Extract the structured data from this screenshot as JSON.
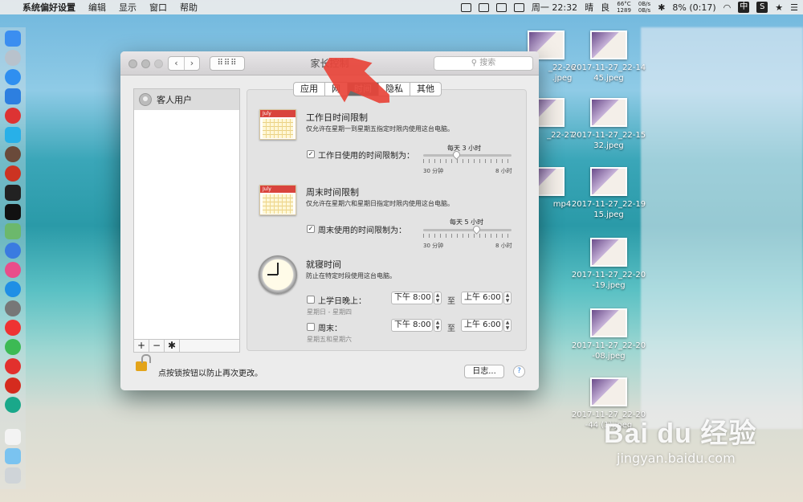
{
  "menubar": {
    "app_name": "系统偏好设置",
    "menus": [
      "编辑",
      "显示",
      "窗口",
      "帮助"
    ],
    "clock": "周一 22:32",
    "weather": "晴",
    "air": "良",
    "cpu_temp": "66°C",
    "cpu_value": "1289",
    "net_up": "0B/s",
    "net_down": "0B/s",
    "battery": "8% (0:17)",
    "input_method": "中",
    "s_badge": "S"
  },
  "window": {
    "title": "家长控制",
    "search_placeholder": "搜索",
    "grid_button": "⠿⠿⠿",
    "users": [
      {
        "name": "客人用户"
      }
    ],
    "list_controls": {
      "add": "+",
      "remove": "−",
      "action": "✱"
    },
    "tabs": [
      {
        "label": "应用",
        "active": false
      },
      {
        "label": "网",
        "active": false
      },
      {
        "label": "时间",
        "active": true
      },
      {
        "label": "隐私",
        "active": false
      },
      {
        "label": "其他",
        "active": false
      }
    ],
    "weekday": {
      "title": "工作日时间限制",
      "desc": "仅允许在星期一到星期五指定时限内使用这台电脑。",
      "checkbox_label": "工作日使用的时间限制为：",
      "checked": true,
      "slider_value": "每天 3 小时",
      "slider_fraction": 0.37,
      "min_label": "30 分钟",
      "max_label": "8 小时"
    },
    "weekend": {
      "title": "周末时间限制",
      "desc": "仅允许在星期六和星期日指定时限内使用这台电脑。",
      "checkbox_label": "周末使用的时间限制为：",
      "checked": true,
      "slider_value": "每天 5 小时",
      "slider_fraction": 0.6,
      "min_label": "30 分钟",
      "max_label": "8 小时"
    },
    "bedtime": {
      "title": "就寝时间",
      "desc": "防止在特定时段使用这台电脑。",
      "school_nights": {
        "label": "上学日晚上：",
        "checked": false,
        "from": "下午 8:00",
        "to": "上午 6:00",
        "days": "星期日 - 星期四"
      },
      "weekend": {
        "label": "周末：",
        "checked": false,
        "from": "下午 8:00",
        "to": "上午 6:00",
        "days": "星期五和星期六"
      },
      "to_word": "至"
    },
    "footer": {
      "lock_text": "点按锁按钮以防止再次更改。",
      "log_button": "日志...",
      "help_button": "?"
    }
  },
  "calendar_month": "July",
  "desktop_files": [
    {
      "label": "_22-26\n.jpeg"
    },
    {
      "label": "2017-11-27_22-14\n45.jpeg"
    },
    {
      "label": "_22-27-"
    },
    {
      "label": "2017-11-27_22-15\n32.jpeg"
    },
    {
      "label": "mp4"
    },
    {
      "label": "2017-11-27_22-19\n15.jpeg"
    },
    {
      "label": "2017-11-27_22-20\n-19.jpeg"
    },
    {
      "label": "2017-11-27_22-20\n-08.jpeg"
    },
    {
      "label": "2017-11-27_22-20\n-44 (1).jpeg"
    }
  ],
  "watermark": {
    "main": "Bai du 经验",
    "sub": "jingyan.baidu.com"
  },
  "colors": {
    "accent_red": "#e8443a",
    "tab_active": "#6b6b6b",
    "lock": "#e3a41a"
  }
}
